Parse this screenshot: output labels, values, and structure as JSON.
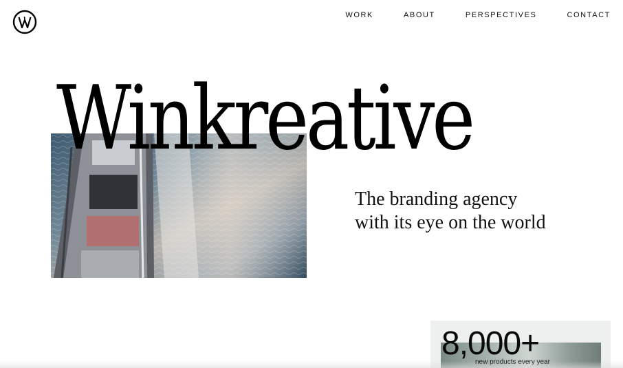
{
  "header": {
    "logo_icon": "winkreative-w-circle-logo",
    "nav": [
      {
        "label": "WORK"
      },
      {
        "label": "ABOUT"
      },
      {
        "label": "PERSPECTIVES"
      },
      {
        "label": "CONTACT"
      }
    ]
  },
  "hero": {
    "wordmark": "Winkreative",
    "image_icon": "yacht-on-sea-photo",
    "tagline_line1": "The branding agency",
    "tagline_line2": "with its eye on the world"
  },
  "stat": {
    "number": "8,000+",
    "label": "new products every year"
  },
  "colors": {
    "background": "#ffffff",
    "text": "#111111"
  }
}
